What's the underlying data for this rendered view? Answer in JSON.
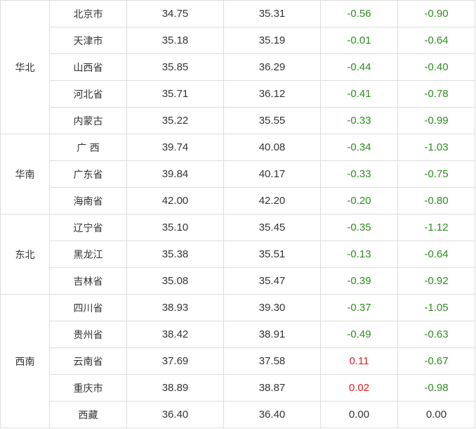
{
  "colors": {
    "negative": "#2e8b1f",
    "positive": "#e02020",
    "neutral": "#333333",
    "border": "#dddddd"
  },
  "regions": [
    {
      "name": "华北",
      "rows": [
        {
          "province": "北京市",
          "v1": "34.75",
          "v2": "35.31",
          "c1": "-0.56",
          "c2": "-0.90"
        },
        {
          "province": "天津市",
          "v1": "35.18",
          "v2": "35.19",
          "c1": "-0.01",
          "c2": "-0.64"
        },
        {
          "province": "山西省",
          "v1": "35.85",
          "v2": "36.29",
          "c1": "-0.44",
          "c2": "-0.40"
        },
        {
          "province": "河北省",
          "v1": "35.71",
          "v2": "36.12",
          "c1": "-0.41",
          "c2": "-0.78"
        },
        {
          "province": "内蒙古",
          "v1": "35.22",
          "v2": "35.55",
          "c1": "-0.33",
          "c2": "-0.99"
        }
      ]
    },
    {
      "name": "华南",
      "rows": [
        {
          "province": "广 西",
          "v1": "39.74",
          "v2": "40.08",
          "c1": "-0.34",
          "c2": "-1.03"
        },
        {
          "province": "广东省",
          "v1": "39.84",
          "v2": "40.17",
          "c1": "-0.33",
          "c2": "-0.75"
        },
        {
          "province": "海南省",
          "v1": "42.00",
          "v2": "42.20",
          "c1": "-0.20",
          "c2": "-0.80"
        }
      ]
    },
    {
      "name": "东北",
      "rows": [
        {
          "province": "辽宁省",
          "v1": "35.10",
          "v2": "35.45",
          "c1": "-0.35",
          "c2": "-1.12"
        },
        {
          "province": "黑龙江",
          "v1": "35.38",
          "v2": "35.51",
          "c1": "-0.13",
          "c2": "-0.64"
        },
        {
          "province": "吉林省",
          "v1": "35.08",
          "v2": "35.47",
          "c1": "-0.39",
          "c2": "-0.92"
        }
      ]
    },
    {
      "name": "西南",
      "rows": [
        {
          "province": "四川省",
          "v1": "38.93",
          "v2": "39.30",
          "c1": "-0.37",
          "c2": "-1.05"
        },
        {
          "province": "贵州省",
          "v1": "38.42",
          "v2": "38.91",
          "c1": "-0.49",
          "c2": "-0.63"
        },
        {
          "province": "云南省",
          "v1": "37.69",
          "v2": "37.58",
          "c1": "0.11",
          "c2": "-0.67"
        },
        {
          "province": "重庆市",
          "v1": "38.89",
          "v2": "38.87",
          "c1": "0.02",
          "c2": "-0.98"
        },
        {
          "province": "西藏",
          "v1": "36.40",
          "v2": "36.40",
          "c1": "0.00",
          "c2": "0.00"
        }
      ]
    }
  ]
}
